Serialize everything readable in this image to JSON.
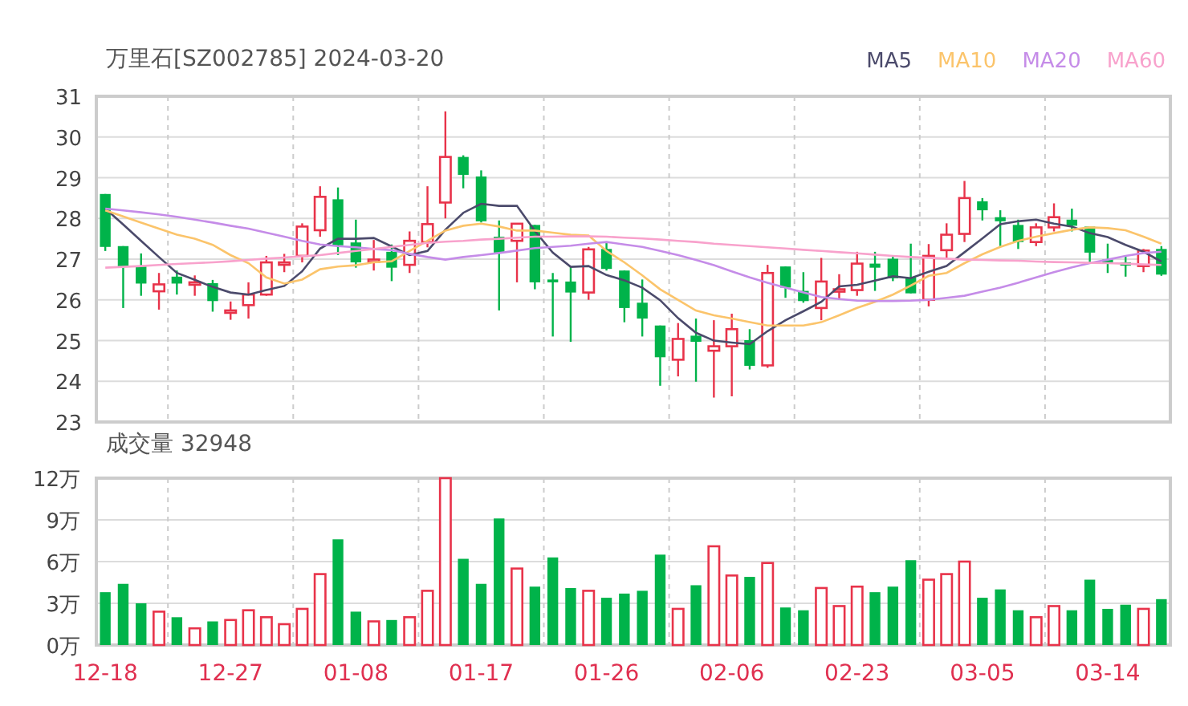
{
  "price_chart": {
    "chart_data": {
      "type": "candlestick",
      "title": "万里石[SZ002785] 2024-03-20",
      "grid": true,
      "categories": [
        null,
        null,
        null,
        null,
        null,
        null,
        null,
        null,
        null,
        null,
        null,
        null,
        null,
        null,
        null,
        null,
        null,
        null,
        null,
        null,
        null,
        null,
        null,
        null,
        null,
        null,
        null,
        null,
        null,
        null,
        null,
        null,
        null,
        null,
        null,
        null,
        null,
        null,
        null,
        null,
        null,
        null,
        null,
        null,
        null,
        null,
        null,
        null,
        null,
        null,
        null,
        null,
        null,
        null,
        null,
        null,
        null,
        null,
        null,
        null
      ],
      "ylim": [
        23,
        31
      ],
      "yticks": [
        31,
        30,
        29,
        28,
        27,
        26,
        25,
        24,
        23
      ],
      "series": [
        {
          "name": "MA5",
          "type": "line",
          "color": "#4b4a6b",
          "values": [
            28.24,
            27.85,
            27.45,
            27.05,
            26.66,
            26.49,
            26.32,
            26.18,
            26.13,
            26.24,
            26.34,
            26.7,
            27.26,
            27.5,
            27.5,
            27.52,
            27.31,
            27.1,
            27.2,
            27.72,
            28.14,
            28.36,
            28.31,
            28.31,
            27.69,
            27.16,
            26.81,
            26.83,
            26.61,
            26.48,
            26.3,
            25.99,
            25.55,
            25.19,
            25.0,
            24.95,
            24.91,
            25.23,
            25.5,
            25.72,
            25.95,
            26.33,
            26.37,
            26.47,
            26.58,
            26.53,
            26.69,
            26.83,
            27.17,
            27.51,
            27.86,
            27.93,
            27.97,
            27.87,
            27.8,
            27.64,
            27.54,
            27.35,
            27.18,
            26.94
          ]
        },
        {
          "name": "MA10",
          "type": "line",
          "color": "#fbc46b",
          "values": [
            28.2,
            28.05,
            27.9,
            27.75,
            27.6,
            27.5,
            27.35,
            27.1,
            26.9,
            26.55,
            26.4,
            26.5,
            26.75,
            26.82,
            26.85,
            26.92,
            26.95,
            27.2,
            27.45,
            27.7,
            27.82,
            27.87,
            27.8,
            27.7,
            27.7,
            27.65,
            27.6,
            27.58,
            27.2,
            26.92,
            26.6,
            26.26,
            26.0,
            25.74,
            25.62,
            25.54,
            25.45,
            25.37,
            25.37,
            25.37,
            25.45,
            25.62,
            25.8,
            25.95,
            26.13,
            26.35,
            26.59,
            26.66,
            26.9,
            27.12,
            27.3,
            27.45,
            27.55,
            27.64,
            27.72,
            27.78,
            27.76,
            27.71,
            27.55,
            27.38
          ]
        },
        {
          "name": "MA20",
          "type": "line",
          "color": "#c58ce8",
          "values": [
            28.24,
            28.2,
            28.15,
            28.1,
            28.04,
            27.97,
            27.9,
            27.82,
            27.75,
            27.65,
            27.55,
            27.45,
            27.36,
            27.32,
            27.29,
            27.25,
            27.22,
            27.13,
            27.05,
            26.99,
            27.05,
            27.1,
            27.15,
            27.21,
            27.27,
            27.3,
            27.33,
            27.38,
            27.42,
            27.36,
            27.3,
            27.2,
            27.1,
            26.98,
            26.85,
            26.7,
            26.55,
            26.42,
            26.3,
            26.18,
            26.07,
            26.02,
            25.98,
            25.97,
            25.97,
            25.98,
            26.0,
            26.05,
            26.1,
            26.2,
            26.3,
            26.42,
            26.55,
            26.68,
            26.8,
            26.9,
            26.99,
            27.08,
            27.15,
            27.18
          ]
        },
        {
          "name": "MA60",
          "type": "line",
          "color": "#f8a2cc",
          "values": [
            26.79,
            26.81,
            26.83,
            26.86,
            26.88,
            26.9,
            26.92,
            26.95,
            26.98,
            27.01,
            27.04,
            27.07,
            27.1,
            27.15,
            27.2,
            27.25,
            27.3,
            27.35,
            27.4,
            27.43,
            27.45,
            27.48,
            27.5,
            27.53,
            27.55,
            27.55,
            27.56,
            27.56,
            27.55,
            27.53,
            27.51,
            27.48,
            27.45,
            27.42,
            27.38,
            27.35,
            27.32,
            27.29,
            27.26,
            27.23,
            27.2,
            27.17,
            27.14,
            27.11,
            27.08,
            27.05,
            27.03,
            27.01,
            26.99,
            26.98,
            26.97,
            26.96,
            26.94,
            26.93,
            26.92,
            26.91,
            26.9,
            26.89,
            26.87,
            26.86
          ]
        }
      ],
      "ohlc": [
        [
          28.6,
          28.6,
          27.2,
          27.3
        ],
        [
          27.32,
          27.32,
          25.8,
          26.82
        ],
        [
          26.82,
          27.14,
          26.1,
          26.4
        ],
        [
          26.21,
          26.66,
          25.76,
          26.38
        ],
        [
          26.57,
          26.72,
          26.13,
          26.4
        ],
        [
          26.4,
          26.6,
          26.1,
          26.43
        ],
        [
          26.41,
          26.49,
          25.71,
          25.97
        ],
        [
          25.7,
          25.96,
          25.51,
          25.74
        ],
        [
          25.87,
          26.43,
          25.54,
          26.13
        ],
        [
          26.13,
          27.08,
          26.1,
          26.92
        ],
        [
          26.9,
          27.13,
          26.68,
          26.92
        ],
        [
          27.08,
          27.88,
          26.92,
          27.8
        ],
        [
          27.71,
          28.79,
          27.55,
          28.53
        ],
        [
          28.47,
          28.76,
          27.1,
          27.34
        ],
        [
          27.41,
          27.97,
          26.79,
          26.92
        ],
        [
          26.93,
          27.47,
          26.72,
          26.99
        ],
        [
          27.18,
          27.36,
          26.46,
          26.79
        ],
        [
          26.86,
          27.68,
          26.66,
          27.45
        ],
        [
          27.42,
          28.79,
          27.29,
          27.86
        ],
        [
          28.39,
          30.63,
          28.0,
          29.51
        ],
        [
          29.51,
          29.55,
          28.74,
          29.07
        ],
        [
          29.03,
          29.18,
          27.9,
          27.93
        ],
        [
          27.55,
          27.95,
          25.74,
          27.16
        ],
        [
          27.45,
          27.87,
          26.43,
          27.87
        ],
        [
          27.84,
          27.84,
          26.26,
          26.43
        ],
        [
          26.5,
          26.66,
          25.1,
          26.43
        ],
        [
          26.45,
          26.8,
          24.97,
          26.18
        ],
        [
          26.18,
          27.3,
          26.0,
          27.24
        ],
        [
          27.25,
          27.42,
          26.72,
          26.76
        ],
        [
          26.72,
          26.72,
          25.45,
          25.8
        ],
        [
          25.93,
          26.5,
          25.1,
          25.54
        ],
        [
          25.37,
          25.37,
          23.89,
          24.59
        ],
        [
          24.53,
          25.43,
          24.12,
          25.04
        ],
        [
          25.12,
          25.54,
          23.99,
          24.97
        ],
        [
          24.75,
          25.5,
          23.6,
          24.86
        ],
        [
          24.86,
          25.66,
          23.63,
          25.28
        ],
        [
          25.01,
          25.28,
          24.29,
          24.38
        ],
        [
          24.39,
          26.86,
          24.33,
          26.66
        ],
        [
          26.82,
          26.82,
          26.05,
          26.3
        ],
        [
          26.22,
          26.68,
          25.93,
          25.97
        ],
        [
          25.8,
          27.03,
          25.5,
          26.45
        ],
        [
          26.22,
          26.63,
          26.0,
          26.26
        ],
        [
          26.24,
          27.18,
          26.1,
          26.89
        ],
        [
          26.89,
          27.18,
          26.22,
          26.79
        ],
        [
          27.01,
          27.08,
          26.46,
          26.53
        ],
        [
          26.55,
          27.38,
          26.16,
          26.16
        ],
        [
          26.0,
          27.37,
          25.84,
          27.08
        ],
        [
          27.22,
          27.88,
          27.03,
          27.6
        ],
        [
          27.62,
          28.92,
          27.42,
          28.5
        ],
        [
          28.42,
          28.5,
          27.95,
          28.2
        ],
        [
          28.03,
          28.2,
          27.32,
          27.93
        ],
        [
          27.84,
          27.97,
          27.25,
          27.42
        ],
        [
          27.42,
          27.88,
          27.32,
          27.78
        ],
        [
          27.78,
          28.37,
          27.68,
          28.03
        ],
        [
          27.97,
          28.24,
          27.68,
          27.82
        ],
        [
          27.8,
          27.8,
          26.89,
          27.16
        ],
        [
          26.99,
          27.38,
          26.66,
          26.89
        ],
        [
          26.92,
          27.08,
          26.57,
          26.84
        ],
        [
          26.83,
          27.25,
          26.68,
          27.21
        ],
        [
          27.25,
          27.32,
          26.59,
          26.62
        ]
      ]
    }
  },
  "volume_chart": {
    "chart_data": {
      "type": "bar",
      "title": "成交量 32948",
      "grid": true,
      "ylim": [
        0,
        12
      ],
      "yticks": [
        {
          "value": 12,
          "label": "12万"
        },
        {
          "value": 9,
          "label": "9万"
        },
        {
          "value": 6,
          "label": "6万"
        },
        {
          "value": 3,
          "label": "3万"
        },
        {
          "value": 0,
          "label": "0万"
        }
      ],
      "values": [
        3.8,
        4.4,
        3.0,
        2.4,
        2.0,
        1.2,
        1.7,
        1.8,
        2.5,
        2.0,
        1.5,
        2.6,
        5.1,
        7.6,
        2.4,
        1.7,
        1.8,
        2.0,
        3.9,
        12.0,
        6.2,
        4.4,
        9.1,
        5.5,
        4.2,
        6.3,
        4.1,
        3.9,
        3.4,
        3.7,
        3.9,
        6.5,
        2.6,
        4.3,
        7.1,
        5.0,
        4.9,
        5.9,
        2.7,
        2.5,
        4.1,
        2.8,
        4.2,
        3.8,
        4.2,
        6.1,
        4.7,
        5.1,
        6.0,
        3.4,
        4.0,
        2.5,
        2.0,
        2.8,
        2.5,
        4.7,
        2.6,
        2.9,
        2.6,
        3.3
      ]
    },
    "date_labels": [
      "12-18",
      "12-27",
      "01-08",
      "01-17",
      "01-26",
      "02-06",
      "02-23",
      "03-05",
      "03-14"
    ]
  }
}
